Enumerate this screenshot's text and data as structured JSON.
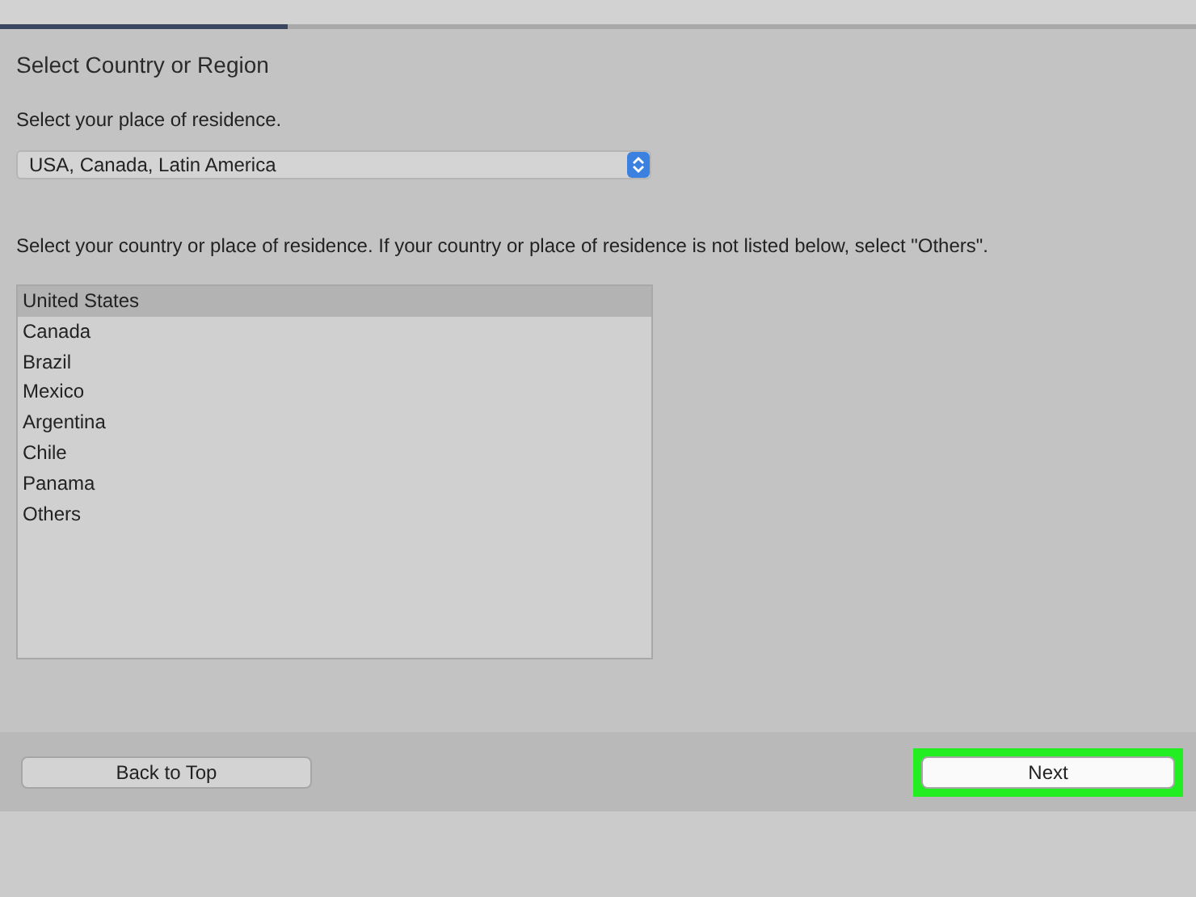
{
  "progress": {
    "level": 0.24
  },
  "heading": "Select Country or Region",
  "region_label": "Select your place of residence.",
  "region_select": {
    "value": "USA, Canada, Latin America"
  },
  "country_label": "Select your country or place of residence. If your country or place of residence is not listed below, select \"Others\".",
  "countries": [
    {
      "label": "United States",
      "selected": true
    },
    {
      "label": "Canada",
      "selected": false
    },
    {
      "label": "Brazil",
      "selected": false
    },
    {
      "label": "Mexico",
      "selected": false
    },
    {
      "label": "Argentina",
      "selected": false
    },
    {
      "label": "Chile",
      "selected": false
    },
    {
      "label": "Panama",
      "selected": false
    },
    {
      "label": "Others",
      "selected": false
    }
  ],
  "buttons": [
    {
      "label": "Back to Top",
      "kind": "secondary",
      "highlighted": false
    },
    {
      "label": "Next",
      "kind": "primary",
      "highlighted": true
    }
  ]
}
